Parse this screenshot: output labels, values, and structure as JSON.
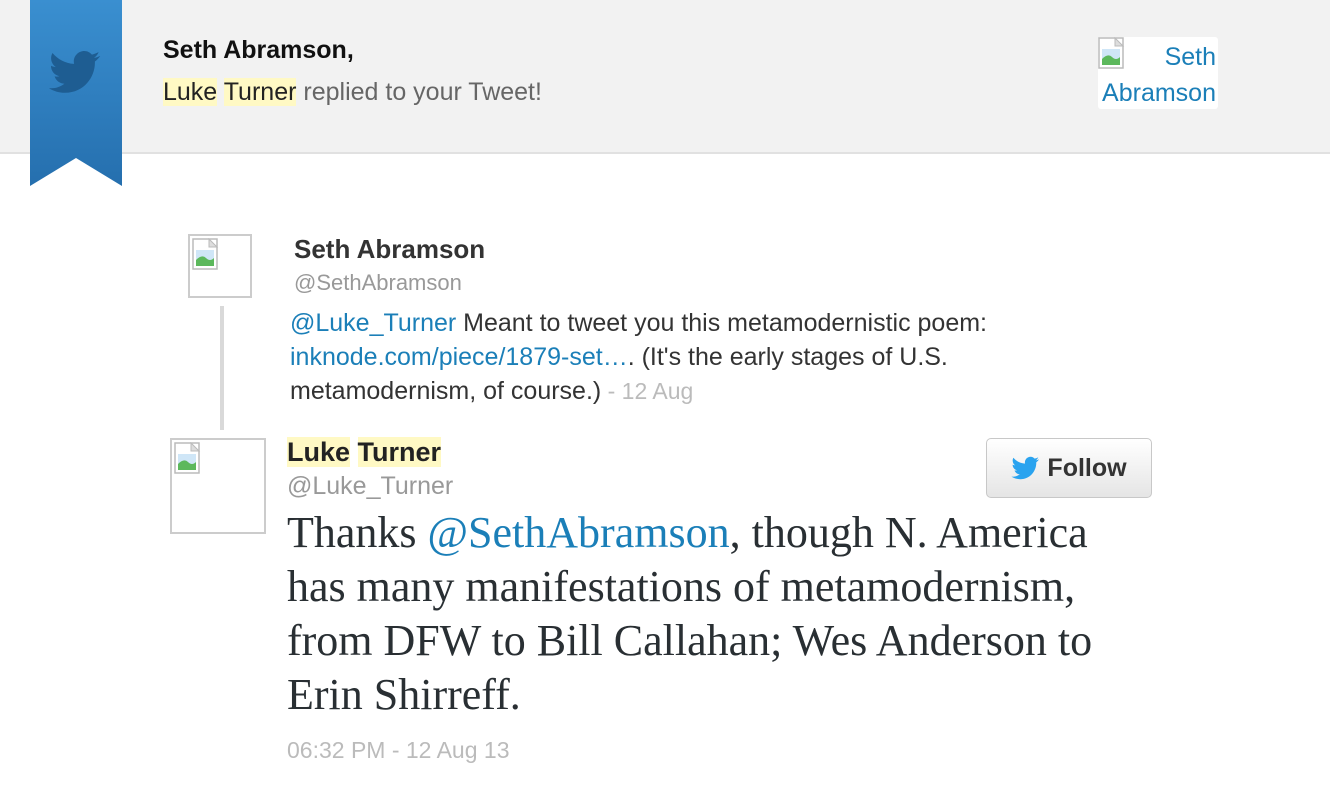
{
  "header": {
    "greeting": "Seth Abramson,",
    "actor_first": "Luke",
    "actor_last": "Turner",
    "action": "replied to your Tweet!",
    "avatar_alt_line1": "Seth",
    "avatar_alt_line2": "Abramson"
  },
  "original_tweet": {
    "name": "Seth Abramson",
    "handle": "@SethAbramson",
    "mention": "@Luke_Turner",
    "text_1": " Meant to tweet you this metamodernistic poem:",
    "link": "inknode.com/piece/1879-set…",
    "text_2": ". (It's the early stages of U.S.",
    "text_3": "metamodernism, of course.)",
    "date": " - 12 Aug"
  },
  "reply_tweet": {
    "name_first": "Luke",
    "name_last": "Turner",
    "handle": "@Luke_Turner",
    "follow_label": "Follow",
    "text_prefix": "Thanks ",
    "mention": "@SethAbramson",
    "text_rest": ", though N. America has many manifestations of metamodernism, from DFW to Bill Callahan; Wes Anderson to Erin Shirreff.",
    "timestamp": "06:32 PM - 12 Aug 13"
  },
  "colors": {
    "brand_blue": "#2b7bb9",
    "link_blue": "#1b7fb8",
    "highlight": "#fff9c4"
  },
  "icons": [
    "twitter-bird-icon",
    "broken-image-icon"
  ]
}
